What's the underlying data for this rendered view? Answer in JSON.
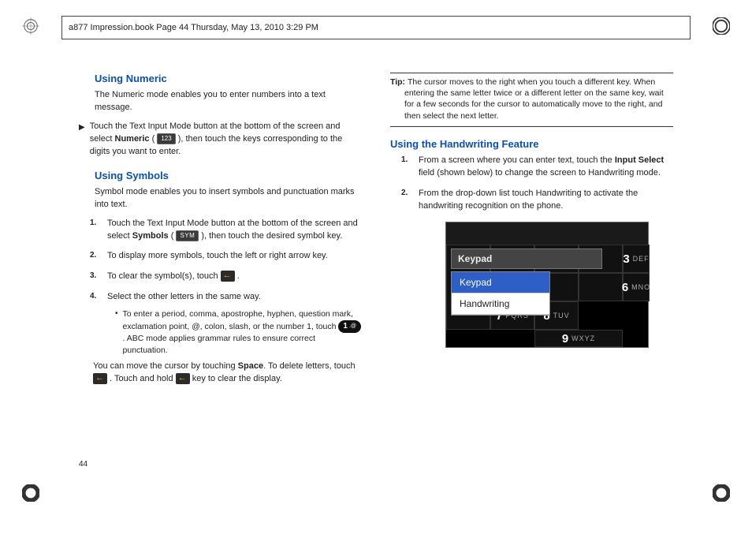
{
  "header": {
    "text": "a877 Impression.book  Page 44  Thursday, May 13, 2010  3:29 PM"
  },
  "pageNumber": "44",
  "left": {
    "numeric": {
      "title": "Using Numeric",
      "intro": "The Numeric mode enables you to enter numbers into a text message.",
      "step_pre": "Touch the Text Input Mode button at the bottom of the screen and select ",
      "step_bold": "Numeric",
      "step_mid": " ( ",
      "chip": "123",
      "step_post": " ), then touch the keys corresponding to the digits you want to enter."
    },
    "symbols": {
      "title": "Using Symbols",
      "intro": "Symbol mode enables you to insert symbols and punctuation marks into text.",
      "steps": [
        {
          "n": "1.",
          "pre": "Touch the Text Input Mode button at the bottom of the screen and select ",
          "bold": "Symbols",
          "mid": " ( ",
          "chip": "SYM",
          "post": " ), then touch the desired symbol key."
        },
        {
          "n": "2.",
          "pre": "To display more symbols, touch the left or right arrow key."
        },
        {
          "n": "3.",
          "pre": "To clear the symbol(s), touch ",
          "hasArrow": true,
          "post": " ."
        },
        {
          "n": "4.",
          "pre": "Select the other letters in the same way.",
          "sub": {
            "dot": "•",
            "pre": "To enter a period, comma, apostrophe, hyphen, question mark, exclamation point, @, colon, slash, or the number 1, touch ",
            "key1": "1",
            "key2": ".@",
            "post": ". ABC mode applies grammar rules to ensure correct punctuation."
          }
        }
      ],
      "tail_pre": "You can move the cursor by touching ",
      "tail_bold": "Space",
      "tail_mid": ". To delete letters, touch ",
      "tail_mid2": " . Touch and hold ",
      "tail_end": " key to clear the display."
    }
  },
  "right": {
    "tip": {
      "label": "Tip: ",
      "text": "The cursor moves to the right when you touch a different key. When entering the same letter twice or a different letter on the same key, wait for a few seconds for the cursor to automatically move to the right, and then select the next letter."
    },
    "hand": {
      "title": "Using the Handwriting Feature",
      "steps": [
        {
          "n": "1.",
          "pre": "From a screen where you can enter text, touch the ",
          "bold1": "Input Select",
          "mid": " field (shown below) to change the screen to Handwriting mode."
        },
        {
          "n": "2.",
          "pre": "From the drop-down list touch Handwriting to activate the handwriting recognition on the phone."
        }
      ]
    }
  },
  "phone": {
    "field": "Keypad",
    "dropdown": [
      "Keypad",
      "Handwriting"
    ],
    "keys": {
      "r1": [
        {
          "b": "",
          "s": ""
        },
        {
          "b": "",
          "s": ""
        },
        {
          "b": "3",
          "s": "DEF"
        }
      ],
      "r2": [
        {
          "b": "",
          "s": ""
        },
        {
          "b": "",
          "s": ""
        },
        {
          "b": "6",
          "s": "MNO"
        }
      ],
      "r3": [
        {
          "b": "7",
          "s": "PQRS"
        },
        {
          "b": "8",
          "s": "TUV"
        },
        {
          "b": "9",
          "s": "WXYZ"
        }
      ]
    }
  }
}
